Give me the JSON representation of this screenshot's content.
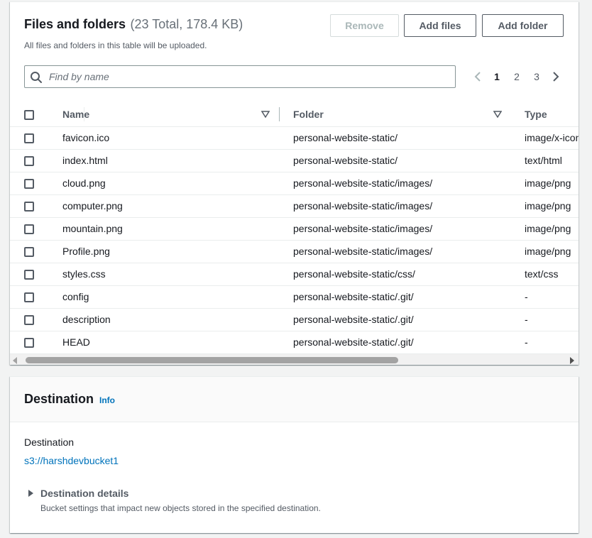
{
  "files_panel": {
    "title": "Files and folders",
    "count": "(23 Total, 178.4 KB)",
    "subtitle": "All files and folders in this table will be uploaded.",
    "buttons": {
      "remove": "Remove",
      "add_files": "Add files",
      "add_folder": "Add folder"
    },
    "search": {
      "placeholder": "Find by name",
      "value": ""
    },
    "pagination": {
      "pages": [
        "1",
        "2",
        "3"
      ],
      "current": "1"
    },
    "table": {
      "columns": [
        "Name",
        "Folder",
        "Type"
      ],
      "rows": [
        {
          "name": "favicon.ico",
          "folder": "personal-website-static/",
          "type": "image/x-icon"
        },
        {
          "name": "index.html",
          "folder": "personal-website-static/",
          "type": "text/html"
        },
        {
          "name": "cloud.png",
          "folder": "personal-website-static/images/",
          "type": "image/png"
        },
        {
          "name": "computer.png",
          "folder": "personal-website-static/images/",
          "type": "image/png"
        },
        {
          "name": "mountain.png",
          "folder": "personal-website-static/images/",
          "type": "image/png"
        },
        {
          "name": "Profile.png",
          "folder": "personal-website-static/images/",
          "type": "image/png"
        },
        {
          "name": "styles.css",
          "folder": "personal-website-static/css/",
          "type": "text/css"
        },
        {
          "name": "config",
          "folder": "personal-website-static/.git/",
          "type": "-"
        },
        {
          "name": "description",
          "folder": "personal-website-static/.git/",
          "type": "-"
        },
        {
          "name": "HEAD",
          "folder": "personal-website-static/.git/",
          "type": "-"
        }
      ]
    }
  },
  "destination_panel": {
    "title": "Destination",
    "info_link": "Info",
    "label": "Destination",
    "value": "s3://harshdevbucket1",
    "details": {
      "title": "Destination details",
      "description": "Bucket settings that impact new objects stored in the specified destination."
    }
  },
  "colors": {
    "link": "#0073bb",
    "border": "#eaeded",
    "text": "#16191f",
    "muted": "#545b64",
    "background": "#f2f3f3"
  }
}
